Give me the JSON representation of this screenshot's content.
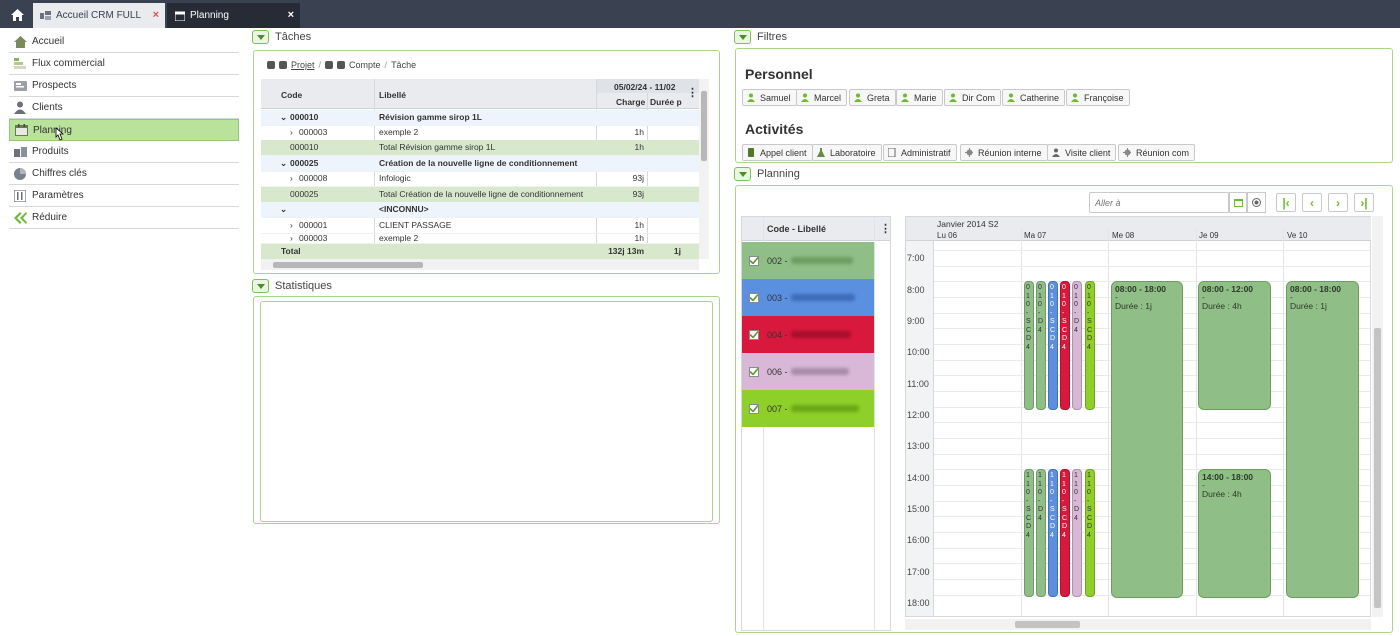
{
  "tabs": [
    {
      "label": "Accueil CRM FULL",
      "close": "×"
    },
    {
      "label": "Planning",
      "close": "×"
    }
  ],
  "sidebar": {
    "items": [
      {
        "label": "Accueil",
        "icon": "home-icon"
      },
      {
        "label": "Flux commercial",
        "icon": "flow-icon"
      },
      {
        "label": "Prospects",
        "icon": "prospects-icon"
      },
      {
        "label": "Clients",
        "icon": "clients-icon"
      },
      {
        "label": "Planning",
        "icon": "planning-icon"
      },
      {
        "label": "Produits",
        "icon": "products-icon"
      },
      {
        "label": "Chiffres clés",
        "icon": "pie-chart-icon"
      },
      {
        "label": "Paramètres",
        "icon": "settings-icon"
      },
      {
        "label": "Réduire",
        "icon": "collapse-icon"
      }
    ]
  },
  "taches": {
    "title": "Tâches",
    "breadcrumb": {
      "projet": "Projet",
      "sep": "/",
      "compte": "Compte",
      "tache": "Tâche"
    },
    "headers": {
      "code": "Code",
      "libelle": "Libellé",
      "period": "05/02/24 - 11/02",
      "charge": "Charge",
      "duree": "Durée p"
    },
    "rows": [
      {
        "code": "000010",
        "label": "Révision gamme sirop 1L",
        "charge": "",
        "duree": "",
        "type": "group"
      },
      {
        "code": "000003",
        "label": "exemple 2",
        "charge": "1h",
        "duree": "",
        "type": "child"
      },
      {
        "code": "000010",
        "label": "Total Révision gamme sirop 1L",
        "charge": "1h",
        "duree": "",
        "type": "total"
      },
      {
        "code": "000025",
        "label": "Création de la nouvelle ligne de conditionnement",
        "charge": "",
        "duree": "",
        "type": "group"
      },
      {
        "code": "000008",
        "label": "Infologic",
        "charge": "93j",
        "duree": "",
        "type": "child"
      },
      {
        "code": "000025",
        "label": "Total Création de la nouvelle ligne de conditionnement",
        "charge": "93j",
        "duree": "",
        "type": "total"
      },
      {
        "code": "",
        "label": "<INCONNU>",
        "charge": "",
        "duree": "",
        "type": "group"
      },
      {
        "code": "000001",
        "label": "CLIENT PASSAGE",
        "charge": "1h",
        "duree": "",
        "type": "child"
      },
      {
        "code": "000003",
        "label": "exemple 2",
        "charge": "1h",
        "duree": "",
        "type": "child"
      }
    ],
    "footer": {
      "label": "Total",
      "charge": "132j 13m",
      "duree": "1j"
    }
  },
  "statistiques": {
    "title": "Statistiques"
  },
  "filtres": {
    "title": "Filtres",
    "personnel_title": "Personnel",
    "personnel": [
      "Samuel",
      "Marcel",
      "Greta",
      "Marie",
      "Dir Com",
      "Catherine",
      "Françoise"
    ],
    "activites_title": "Activités",
    "activites": [
      "Appel client",
      "Laboratoire",
      "Administratif",
      "Réunion interne",
      "Visite client",
      "Réunion com"
    ]
  },
  "planning": {
    "title": "Planning",
    "goto_placeholder": "Aller à",
    "resource_header": "Code - Libellé",
    "resources": [
      {
        "code": "002 -",
        "color": "#8fbf86"
      },
      {
        "code": "003 -",
        "color": "#5b8fe0"
      },
      {
        "code": "004 -",
        "color": "#d9183d"
      },
      {
        "code": "006 -",
        "color": "#d8b8d6"
      },
      {
        "code": "007 -",
        "color": "#8ecf2a"
      }
    ],
    "week_label": "Janvier 2014 S2",
    "days": [
      "Lu 06",
      "Ma 07",
      "Me 08",
      "Je 09",
      "Ve 10"
    ],
    "hours": [
      "7:00",
      "8:00",
      "9:00",
      "10:00",
      "11:00",
      "12:00",
      "13:00",
      "14:00",
      "15:00",
      "16:00",
      "17:00",
      "18:00"
    ],
    "events": [
      {
        "time": "08:00 - 18:00",
        "sub": "-",
        "duration": "Durée : 1j"
      },
      {
        "time": "08:00 - 12:00",
        "sub": "-",
        "duration": "Durée : 4h"
      },
      {
        "time": "14:00 - 18:00",
        "sub": "-",
        "duration": "Durée : 4h"
      },
      {
        "time": "08:00 - 18:00",
        "sub": "-",
        "duration": "Durée : 1j"
      }
    ]
  }
}
